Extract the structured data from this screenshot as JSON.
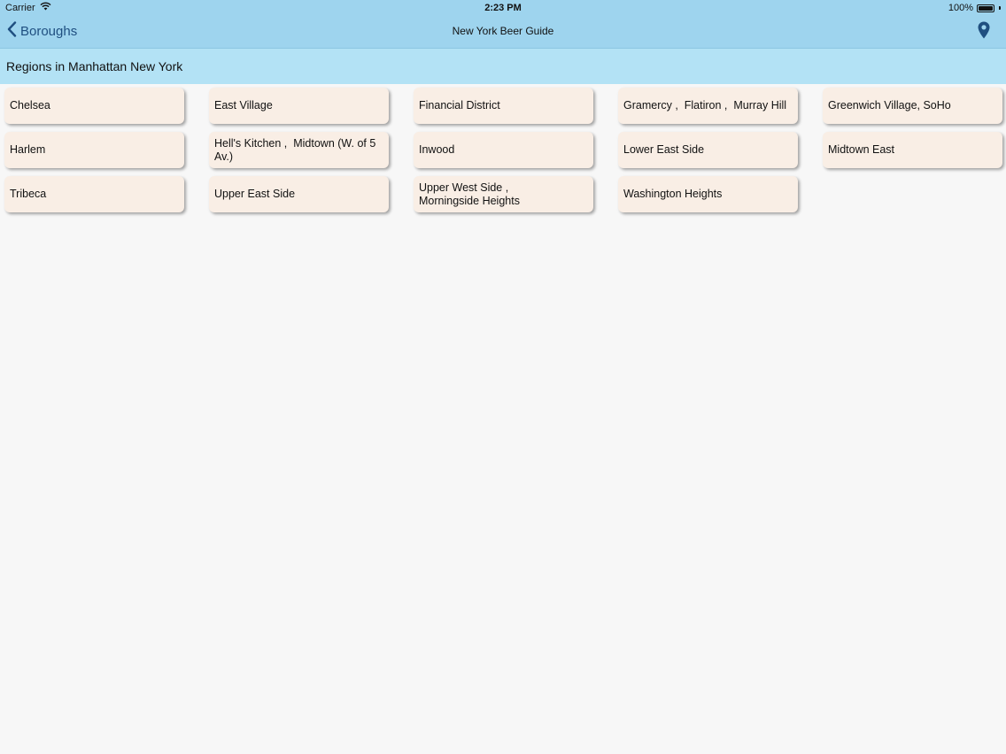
{
  "status_bar": {
    "carrier": "Carrier",
    "time": "2:23 PM",
    "battery": "100%"
  },
  "nav": {
    "back_label": "Boroughs",
    "title": "New York Beer Guide"
  },
  "section": {
    "title": "Regions in Manhattan New York"
  },
  "regions": [
    {
      "label": "Chelsea"
    },
    {
      "label": "East Village"
    },
    {
      "label": "Financial District"
    },
    {
      "label": "Gramercy ,  Flatiron ,  Murray Hill"
    },
    {
      "label": "Greenwich Village, SoHo"
    },
    {
      "label": "Harlem"
    },
    {
      "label": "Hell's Kitchen ,  Midtown (W. of 5 Av.)"
    },
    {
      "label": "Inwood"
    },
    {
      "label": "Lower East Side"
    },
    {
      "label": "Midtown East"
    },
    {
      "label": "Tribeca"
    },
    {
      "label": "Upper East Side"
    },
    {
      "label": "Upper West Side ,\nMorningside Heights"
    },
    {
      "label": "Washington Heights"
    }
  ],
  "colors": {
    "nav_background": "#9ed4ee",
    "section_background": "#b3e2f5",
    "card_background": "#f9eee5",
    "accent": "#1f4f80"
  },
  "icons": {
    "wifi": "wifi-icon",
    "battery": "battery-icon",
    "back": "chevron-left-icon",
    "map": "map-pin-icon"
  }
}
